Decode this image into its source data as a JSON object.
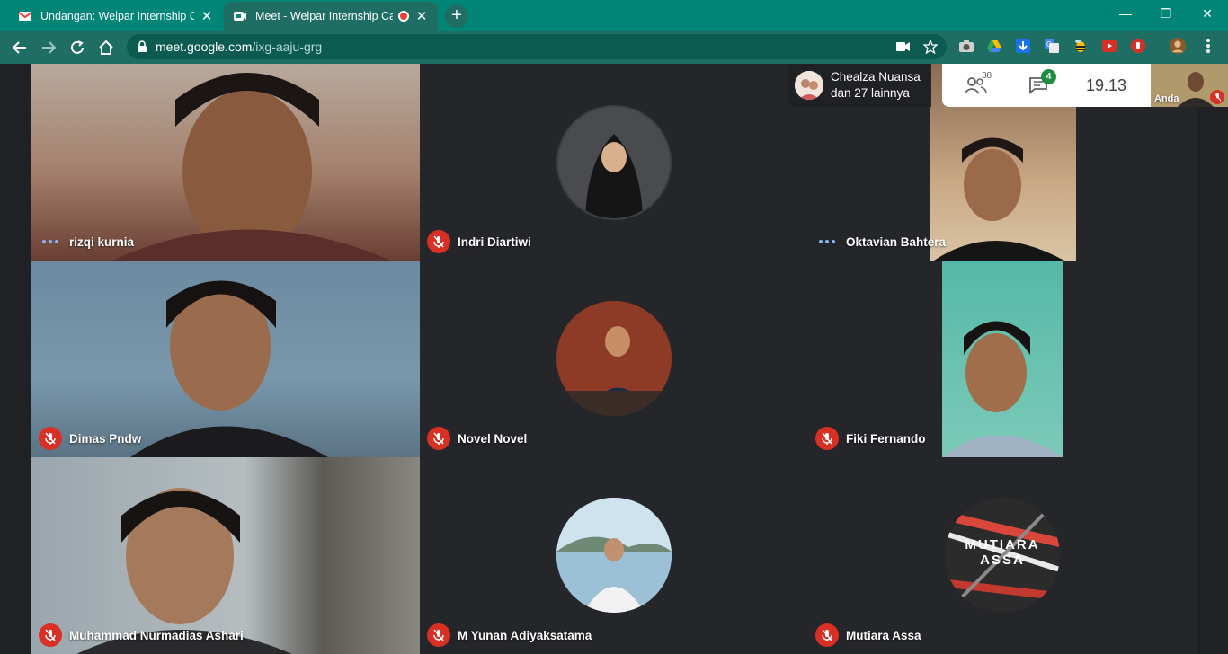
{
  "browser": {
    "tabs": [
      {
        "title": "Undangan: Welpar Internship Car",
        "close": "✕"
      },
      {
        "title": "Meet - Welpar Internship Car",
        "close": "✕"
      }
    ],
    "new_tab": "+",
    "window_controls": {
      "minimize": "—",
      "restore": "❐",
      "close": "✕"
    },
    "address": {
      "host": "meet.google.com",
      "path": "/ixg-aaju-grg"
    },
    "theme_color": "#008577"
  },
  "meet": {
    "pinned": {
      "line1": "Chealza Nuansa",
      "line2": "dan 27 lainnya"
    },
    "participants_count": "38",
    "chat_count": "4",
    "clock": "19.13",
    "self_label": "Anda",
    "tiles": [
      {
        "name": "rizqi kurnia",
        "status": "speaking"
      },
      {
        "name": "Indri Diartiwi",
        "status": "muted"
      },
      {
        "name": "Oktavian Bahtera",
        "status": "speaking"
      },
      {
        "name": "Dimas Pndw",
        "status": "muted"
      },
      {
        "name": "Novel Novel",
        "status": "muted"
      },
      {
        "name": "Fiki Fernando",
        "status": "muted"
      },
      {
        "name": "Muhammad Nurmadias Ashari",
        "status": "muted"
      },
      {
        "name": "M Yunan Adiyaksatama",
        "status": "muted"
      },
      {
        "name": "Mutiara Assa",
        "status": "muted"
      }
    ],
    "mutiara_avatar_text": [
      "MUTIARA",
      "ASSA"
    ],
    "mute_color": "#d93025",
    "speaking_color": "#8ab4f8"
  }
}
